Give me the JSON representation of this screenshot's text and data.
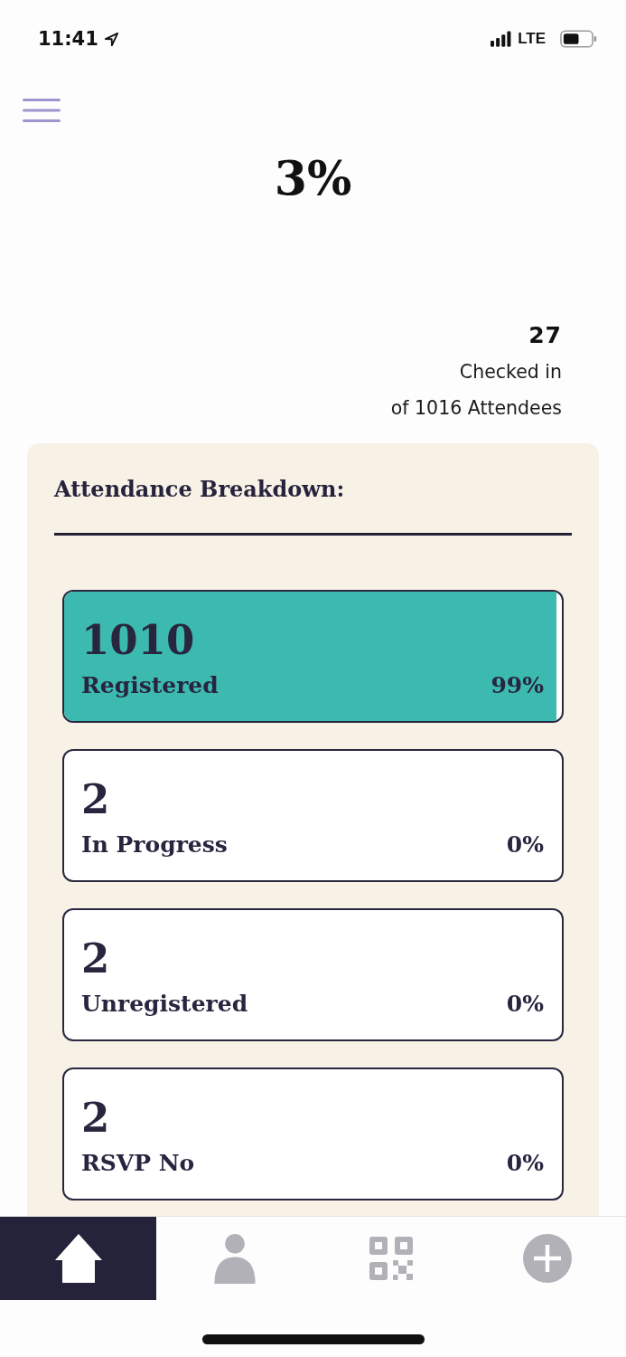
{
  "status_bar": {
    "time": "11:41",
    "network": "LTE"
  },
  "header": {
    "percent": "3%"
  },
  "summary": {
    "count": "27",
    "label": "Checked in",
    "total": "of 1016 Attendees"
  },
  "breakdown": {
    "title": "Attendance Breakdown:",
    "items": [
      {
        "count": "1010",
        "label": "Registered",
        "percent": "99%",
        "level": 0.99
      },
      {
        "count": "2",
        "label": "In Progress",
        "percent": "0%"
      },
      {
        "count": "2",
        "label": "Unregistered",
        "percent": "0%"
      },
      {
        "count": "2",
        "label": "RSVP No",
        "percent": "0%"
      }
    ]
  },
  "tab_bar": {
    "tabs": [
      {
        "kind": "home",
        "selected": true
      },
      {
        "kind": "person",
        "selected": false
      },
      {
        "kind": "qr",
        "selected": false
      },
      {
        "kind": "add",
        "selected": false
      }
    ]
  }
}
